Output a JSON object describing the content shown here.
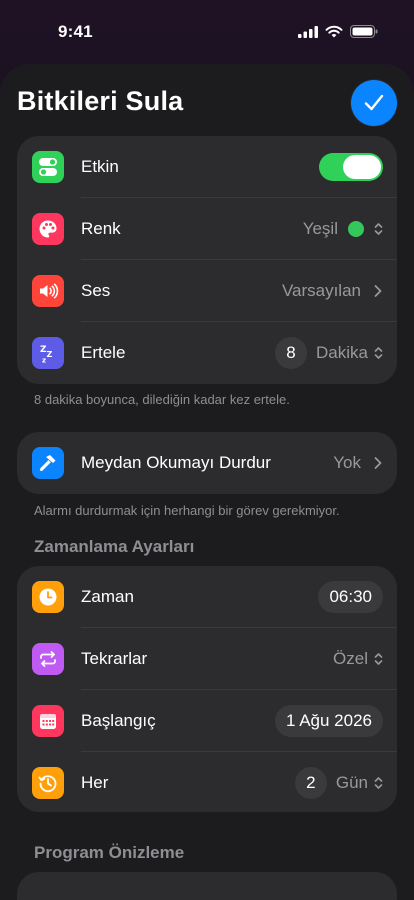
{
  "status": {
    "time": "9:41"
  },
  "header": {
    "title": "Bitkileri Sula"
  },
  "alarm_group": {
    "enabled": {
      "label": "Etkin",
      "on": true
    },
    "color": {
      "label": "Renk",
      "value": "Yeşil",
      "swatch": "#34c759"
    },
    "sound": {
      "label": "Ses",
      "value": "Varsayılan"
    },
    "snooze": {
      "label": "Ertele",
      "count": "8",
      "unit": "Dakika"
    }
  },
  "snooze_note": "8 dakika boyunca, dilediğin kadar kez ertele.",
  "challenge_group": {
    "row": {
      "label": "Meydan Okumayı Durdur",
      "value": "Yok"
    }
  },
  "challenge_note": "Alarmı durdurmak için herhangi bir görev gerekmiyor.",
  "schedule": {
    "header": "Zamanlama Ayarları",
    "time": {
      "label": "Zaman",
      "value": "06:30"
    },
    "repeats": {
      "label": "Tekrarlar",
      "value": "Özel"
    },
    "start": {
      "label": "Başlangıç",
      "value": "1 Ağu 2026"
    },
    "every": {
      "label": "Her",
      "count": "2",
      "unit": "Gün"
    }
  },
  "preview": {
    "header": "Program Önizleme"
  },
  "colors": {
    "accent": "#0a84ff",
    "toggle_on": "#30d158",
    "icon_green": "#30d158",
    "icon_red": "#ff375f",
    "icon_red2": "#ff453a",
    "icon_indigo": "#5e5ce6",
    "icon_blue": "#0a84ff",
    "icon_orange": "#ff9f0a",
    "icon_purple": "#bf5af2"
  }
}
